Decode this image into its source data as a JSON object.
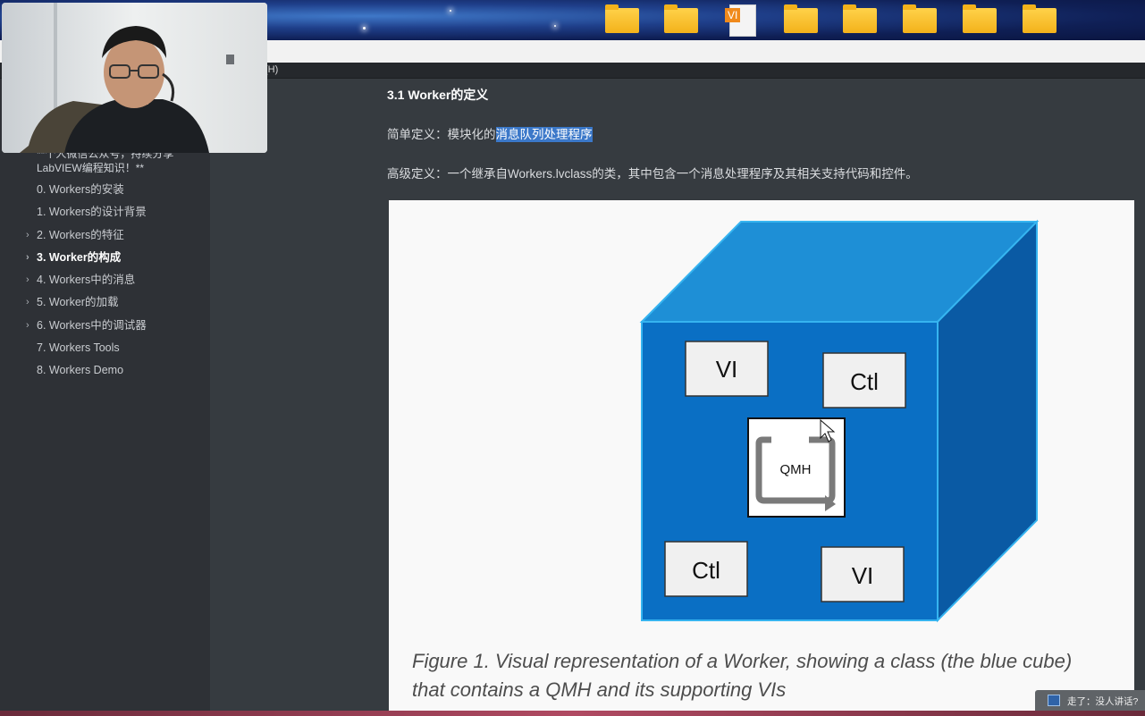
{
  "desktop": {
    "icons": [
      {
        "type": "folder"
      },
      {
        "type": "folder"
      },
      {
        "type": "vi-file",
        "badge": "VI"
      },
      {
        "type": "folder"
      },
      {
        "type": "folder"
      },
      {
        "type": "folder"
      },
      {
        "type": "folder"
      },
      {
        "type": "folder"
      }
    ]
  },
  "menubar": {
    "help_fragment": "(H)"
  },
  "sidebar": {
    "intro_text": "**个人微信公众号，持续分享LabVIEW编程知识！**",
    "toc": [
      {
        "label": "0. Workers的安装",
        "expandable": false,
        "active": false
      },
      {
        "label": "1. Workers的设计背景",
        "expandable": false,
        "active": false
      },
      {
        "label": "2. Workers的特征",
        "expandable": true,
        "active": false
      },
      {
        "label": "3. Worker的构成",
        "expandable": true,
        "active": true
      },
      {
        "label": "4. Workers中的消息",
        "expandable": true,
        "active": false
      },
      {
        "label": "5. Worker的加载",
        "expandable": true,
        "active": false
      },
      {
        "label": "6. Workers中的调试器",
        "expandable": true,
        "active": false
      },
      {
        "label": "7. Workers Tools",
        "expandable": false,
        "active": false
      },
      {
        "label": "8. Workers Demo",
        "expandable": false,
        "active": false
      }
    ],
    "footer": {
      "collapse": "<",
      "source": "</>"
    }
  },
  "content": {
    "heading": "3.1 Worker的定义",
    "simple_prefix": "简单定义：模块化的",
    "simple_highlight": "消息队列处理程序",
    "advanced": "高级定义：一个继承自Workers.lvclass的类，其中包含一个消息处理程序及其相关支持代码和控件。",
    "figure": {
      "boxes": {
        "top_left": "VI",
        "top_right": "Ctl",
        "center": "QMH",
        "bottom_left": "Ctl",
        "bottom_right": "VI"
      },
      "caption_line1": "Figure 1. Visual representation of a Worker, showing a class (the blue cube)",
      "caption_line2": "that contains a QMH and its supporting VIs",
      "colors": {
        "front": "#0a6fc4",
        "top": "#1e8fd6",
        "side": "#0a5aa4",
        "edge": "#36b4f0"
      }
    }
  },
  "notification": {
    "text": "走了：没人讲话?"
  }
}
